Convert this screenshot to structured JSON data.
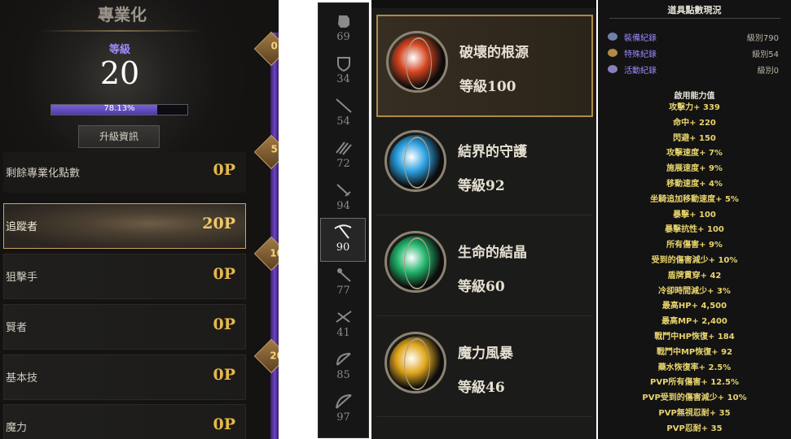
{
  "specialization": {
    "title": "專業化",
    "level_label": "等級",
    "level_value": "20",
    "progress_text": "78.13%",
    "progress_percent": 78.13,
    "upgrade_button": "升級資訊",
    "rail_badges": [
      "0",
      "5",
      "10",
      "20"
    ],
    "rows": [
      {
        "label": "剩餘專業化點數",
        "points": "0P"
      },
      {
        "label": "追蹤者",
        "points": "20P",
        "selected": true
      },
      {
        "label": "狙擊手",
        "points": "0P"
      },
      {
        "label": "賢者",
        "points": "0P"
      },
      {
        "label": "基本技",
        "points": "0P"
      },
      {
        "label": "魔力",
        "points": "0P"
      }
    ]
  },
  "weapons": [
    {
      "icon": "gauntlet-icon",
      "value": "69"
    },
    {
      "icon": "shield-icon",
      "value": "34"
    },
    {
      "icon": "spear-icon",
      "value": "54"
    },
    {
      "icon": "claw-icon",
      "value": "72"
    },
    {
      "icon": "sword-icon",
      "value": "94"
    },
    {
      "icon": "scythe-icon",
      "value": "90",
      "selected": true
    },
    {
      "icon": "staff-icon",
      "value": "77"
    },
    {
      "icon": "crossbow-icon",
      "value": "41"
    },
    {
      "icon": "bow-icon",
      "value": "85"
    },
    {
      "icon": "longbow-icon",
      "value": "97"
    }
  ],
  "gems": [
    {
      "name": "破壞的根源",
      "level": "等級100",
      "color": "#d2431e",
      "selected": true
    },
    {
      "name": "結界的守護",
      "level": "等級92",
      "color": "#2a9fe0"
    },
    {
      "name": "生命的結晶",
      "level": "等級60",
      "color": "#1fb36a"
    },
    {
      "name": "魔力風暴",
      "level": "等級46",
      "color": "#e0a51b"
    }
  ],
  "stats": {
    "header": "道具點數現況",
    "records": [
      {
        "label": "裝備紀錄",
        "value": "級別790",
        "icon": "equipment-record-icon"
      },
      {
        "label": "特殊紀錄",
        "value": "級別54",
        "icon": "special-record-icon"
      },
      {
        "label": "活動紀錄",
        "value": "級別0",
        "icon": "activity-record-icon"
      }
    ],
    "subheader": "啟用能力值",
    "lines": [
      "攻擊力+ 339",
      "命中+ 220",
      "閃避+ 150",
      "攻擊速度+ 7%",
      "施展速度+ 9%",
      "移動速度+ 4%",
      "坐騎追加移動速度+ 5%",
      "暴擊+ 100",
      "暴擊抗性+ 100",
      "所有傷害+ 9%",
      "受到的傷害減少+ 10%",
      "盾牌貫穿+ 42",
      "冷卻時間減少+ 3%",
      "最高HP+ 4,500",
      "最高MP+ 2,400",
      "戰鬥中HP恢復+ 184",
      "戰鬥中MP恢復+ 92",
      "藥水恢復率+ 2.5%",
      "PVP所有傷害+ 12.5%",
      "PVP受到的傷害減少+ 10%",
      "PVP無視忍耐+ 35",
      "PVP忍耐+ 35"
    ]
  }
}
